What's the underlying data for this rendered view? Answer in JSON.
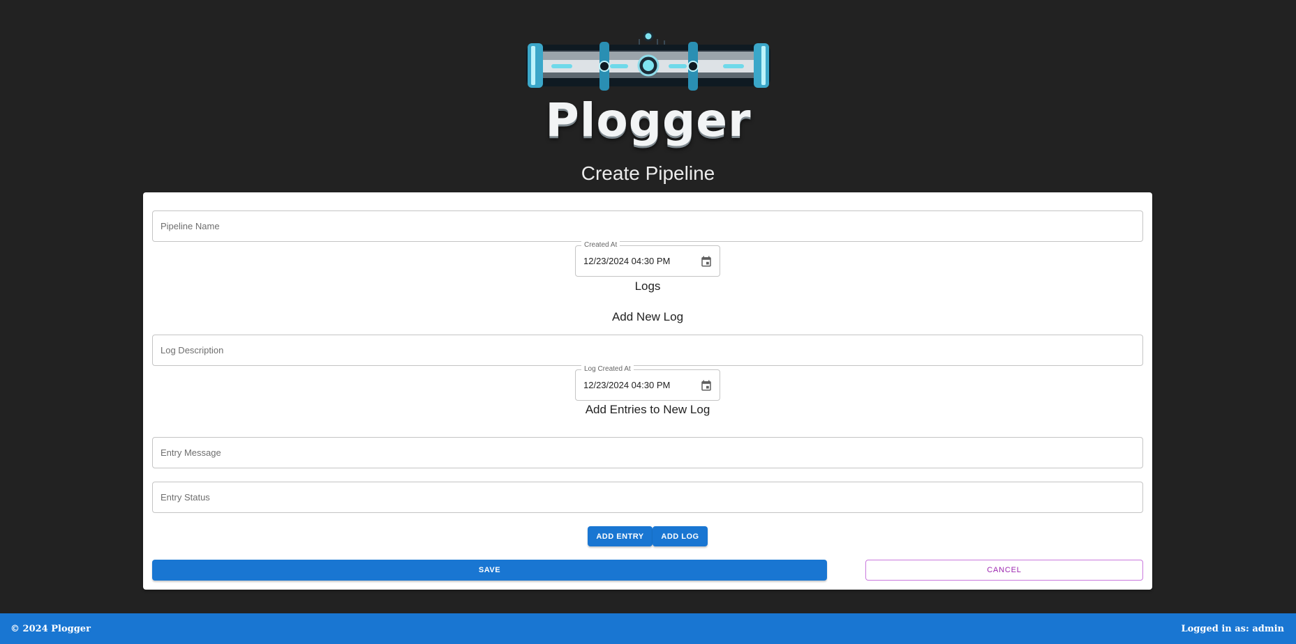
{
  "app": {
    "name": "Plogger"
  },
  "page": {
    "title": "Create Pipeline"
  },
  "form": {
    "pipeline_name_placeholder": "Pipeline Name",
    "created_at_label": "Created At",
    "created_at_value": "12/23/2024 04:30 PM",
    "logs_heading": "Logs",
    "add_new_log_heading": "Add New Log",
    "log_description_placeholder": "Log Description",
    "log_created_at_label": "Log Created At",
    "log_created_at_value": "12/23/2024 04:30 PM",
    "add_entries_heading": "Add Entries to New Log",
    "entry_message_placeholder": "Entry Message",
    "entry_status_placeholder": "Entry Status"
  },
  "actions": {
    "add_entry_label": "ADD ENTRY",
    "add_log_label": "ADD LOG",
    "save_label": "SAVE",
    "cancel_label": "CANCEL"
  },
  "footer": {
    "copyright": "© 2024 Plogger",
    "logged_in": "Logged in as: admin"
  },
  "icons": {
    "logo": "pipeline-logo-icon",
    "calendar": "calendar-icon"
  },
  "colors": {
    "background": "#222222",
    "primary": "#1976d2",
    "secondary": "#9c27b0"
  }
}
